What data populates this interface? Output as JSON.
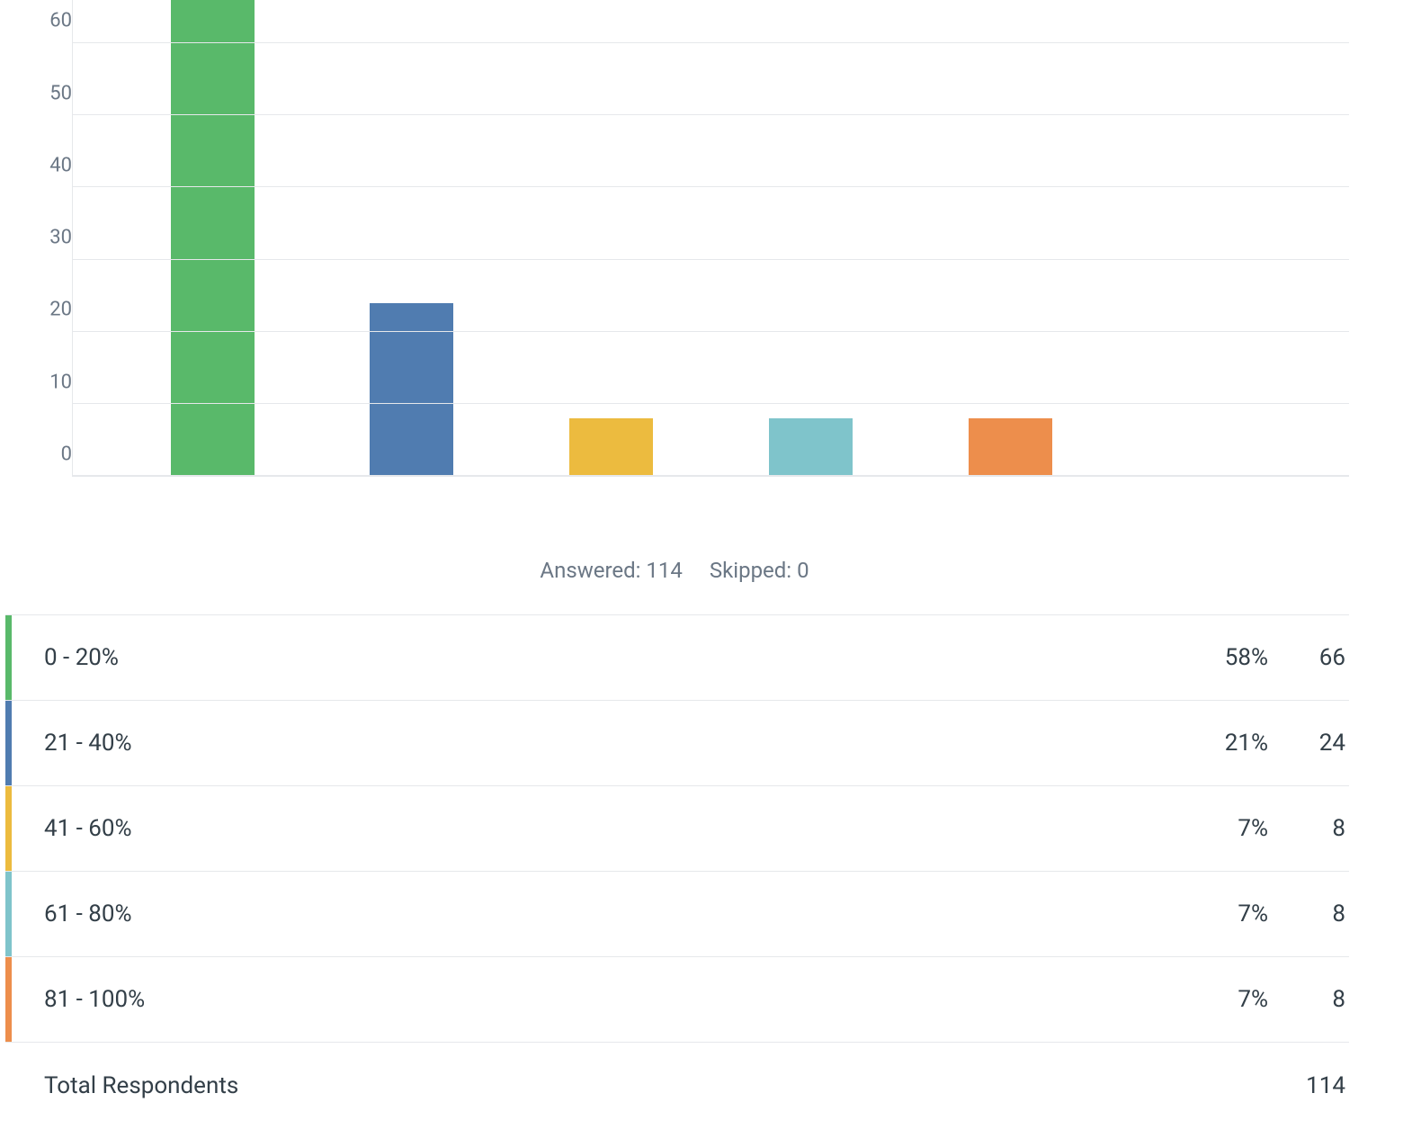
{
  "chart_data": {
    "type": "bar",
    "categories": [
      "0 - 20%",
      "21 - 40%",
      "41 - 60%",
      "61 - 80%",
      "81 - 100%"
    ],
    "values": [
      66,
      24,
      8,
      8,
      8
    ],
    "percentages": [
      "58%",
      "21%",
      "7%",
      "7%",
      "7%"
    ],
    "colors": [
      "#59b96a",
      "#507cb0",
      "#ecbb3f",
      "#7fc4cb",
      "#ed8e4c"
    ],
    "ylim": [
      0,
      66
    ],
    "y_ticks": [
      0,
      10,
      20,
      30,
      40,
      50,
      60
    ],
    "title": "",
    "xlabel": "",
    "ylabel": ""
  },
  "summary": {
    "answered_label": "Answered: 114",
    "skipped_label": "Skipped: 0"
  },
  "table": {
    "rows": [
      {
        "label": "0 - 20%",
        "pct": "58%",
        "count": "66",
        "color": "#59b96a"
      },
      {
        "label": "21 - 40%",
        "pct": "21%",
        "count": "24",
        "color": "#507cb0"
      },
      {
        "label": "41 - 60%",
        "pct": "7%",
        "count": "8",
        "color": "#ecbb3f"
      },
      {
        "label": "61 - 80%",
        "pct": "7%",
        "count": "8",
        "color": "#7fc4cb"
      },
      {
        "label": "81 - 100%",
        "pct": "7%",
        "count": "8",
        "color": "#ed8e4c"
      }
    ],
    "total_label": "Total Respondents",
    "total_count": "114"
  }
}
